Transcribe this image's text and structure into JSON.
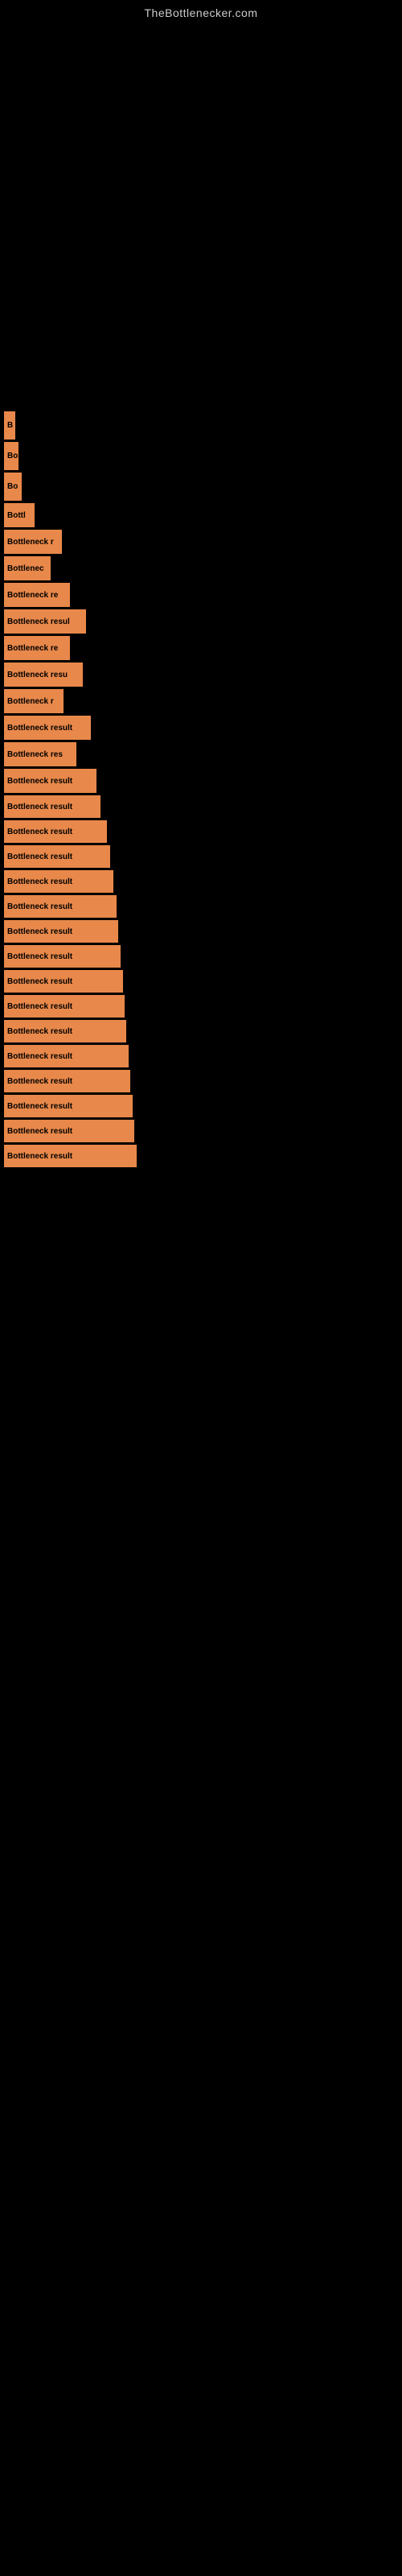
{
  "site": {
    "title": "TheBottlenecker.com"
  },
  "bars": [
    {
      "id": 1,
      "label": "",
      "width": 0,
      "height": 40
    },
    {
      "id": 2,
      "label": "",
      "width": 0,
      "height": 40
    },
    {
      "id": 3,
      "label": "",
      "width": 0,
      "height": 40
    },
    {
      "id": 4,
      "label": "",
      "width": 0,
      "height": 40
    },
    {
      "id": 5,
      "label": "",
      "width": 0,
      "height": 40
    },
    {
      "id": 6,
      "label": "",
      "width": 0,
      "height": 40
    },
    {
      "id": 7,
      "label": "",
      "width": 0,
      "height": 40
    },
    {
      "id": 8,
      "label": "",
      "width": 0,
      "height": 40
    },
    {
      "id": 9,
      "label": "",
      "width": 0,
      "height": 40
    },
    {
      "id": 10,
      "label": "",
      "width": 0,
      "height": 40
    },
    {
      "id": 11,
      "label": "",
      "width": 0,
      "height": 40
    },
    {
      "id": 12,
      "label": "B",
      "width": 14,
      "height": 35
    },
    {
      "id": 13,
      "label": "Bo",
      "width": 18,
      "height": 35
    },
    {
      "id": 14,
      "label": "Bo",
      "width": 22,
      "height": 35
    },
    {
      "id": 15,
      "label": "Bottl",
      "width": 38,
      "height": 30
    },
    {
      "id": 16,
      "label": "Bottleneck r",
      "width": 72,
      "height": 30
    },
    {
      "id": 17,
      "label": "Bottlenec",
      "width": 58,
      "height": 30
    },
    {
      "id": 18,
      "label": "Bottleneck re",
      "width": 82,
      "height": 30
    },
    {
      "id": 19,
      "label": "Bottleneck resul",
      "width": 102,
      "height": 30
    },
    {
      "id": 20,
      "label": "Bottleneck re",
      "width": 82,
      "height": 30
    },
    {
      "id": 21,
      "label": "Bottleneck resu",
      "width": 98,
      "height": 30
    },
    {
      "id": 22,
      "label": "Bottleneck r",
      "width": 74,
      "height": 30
    },
    {
      "id": 23,
      "label": "Bottleneck result",
      "width": 108,
      "height": 30
    },
    {
      "id": 24,
      "label": "Bottleneck res",
      "width": 90,
      "height": 30
    },
    {
      "id": 25,
      "label": "Bottleneck result",
      "width": 115,
      "height": 30
    },
    {
      "id": 26,
      "label": "Bottleneck result",
      "width": 120,
      "height": 28
    },
    {
      "id": 27,
      "label": "Bottleneck result",
      "width": 128,
      "height": 28
    },
    {
      "id": 28,
      "label": "Bottleneck result",
      "width": 132,
      "height": 28
    },
    {
      "id": 29,
      "label": "Bottleneck result",
      "width": 136,
      "height": 28
    },
    {
      "id": 30,
      "label": "Bottleneck result",
      "width": 140,
      "height": 28
    },
    {
      "id": 31,
      "label": "Bottleneck result",
      "width": 142,
      "height": 28
    },
    {
      "id": 32,
      "label": "Bottleneck result",
      "width": 145,
      "height": 28
    },
    {
      "id": 33,
      "label": "Bottleneck result",
      "width": 148,
      "height": 28
    },
    {
      "id": 34,
      "label": "Bottleneck result",
      "width": 150,
      "height": 28
    },
    {
      "id": 35,
      "label": "Bottleneck result",
      "width": 152,
      "height": 28
    },
    {
      "id": 36,
      "label": "Bottleneck result",
      "width": 155,
      "height": 28
    },
    {
      "id": 37,
      "label": "Bottleneck result",
      "width": 157,
      "height": 28
    },
    {
      "id": 38,
      "label": "Bottleneck result",
      "width": 160,
      "height": 28
    },
    {
      "id": 39,
      "label": "Bottleneck result",
      "width": 162,
      "height": 28
    },
    {
      "id": 40,
      "label": "Bottleneck result",
      "width": 165,
      "height": 28
    }
  ],
  "colors": {
    "bar": "#e8884a",
    "background": "#000000",
    "text": "#000000",
    "siteTitle": "#cccccc"
  }
}
